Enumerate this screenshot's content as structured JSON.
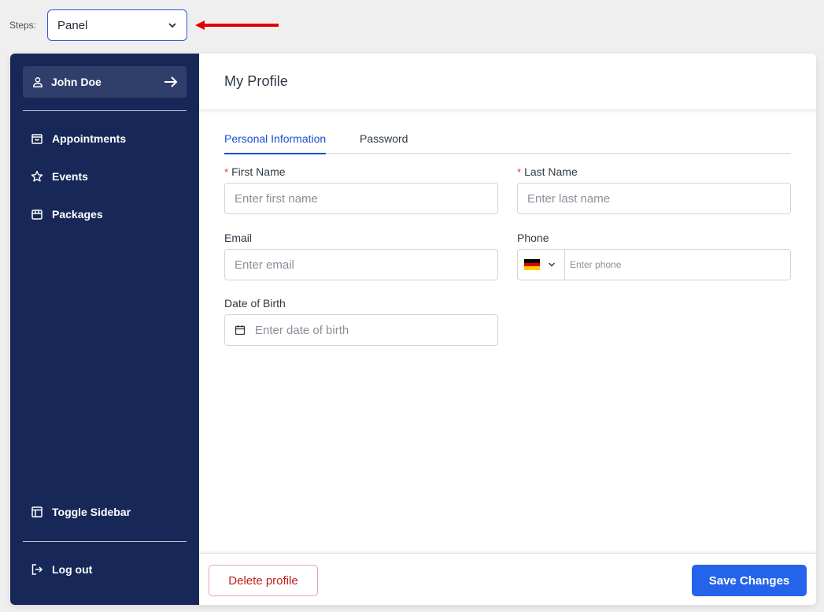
{
  "steps": {
    "label": "Steps:",
    "selected": "Panel"
  },
  "annotation": {
    "arrow_color": "#e00000"
  },
  "sidebar": {
    "user": {
      "name": "John Doe"
    },
    "items": [
      {
        "label": "Appointments",
        "icon": "shopping-bag-icon"
      },
      {
        "label": "Events",
        "icon": "star-icon"
      },
      {
        "label": "Packages",
        "icon": "package-icon"
      }
    ],
    "toggle_label": "Toggle Sidebar",
    "logout_label": "Log out",
    "background": "#172858"
  },
  "header": {
    "title": "My Profile"
  },
  "tabs": [
    {
      "label": "Personal Information",
      "active": true
    },
    {
      "label": "Password",
      "active": false
    }
  ],
  "form": {
    "first_name": {
      "label": "First Name",
      "required": "*",
      "placeholder": "Enter first name"
    },
    "last_name": {
      "label": "Last Name",
      "required": "*",
      "placeholder": "Enter last name"
    },
    "email": {
      "label": "Email",
      "placeholder": "Enter email"
    },
    "phone": {
      "label": "Phone",
      "placeholder": "Enter phone",
      "country": "DE"
    },
    "dob": {
      "label": "Date of Birth",
      "placeholder": "Enter date of birth"
    }
  },
  "footer": {
    "delete_label": "Delete profile",
    "save_label": "Save Changes",
    "accent": "#2563eb",
    "danger": "#c21c1c"
  }
}
